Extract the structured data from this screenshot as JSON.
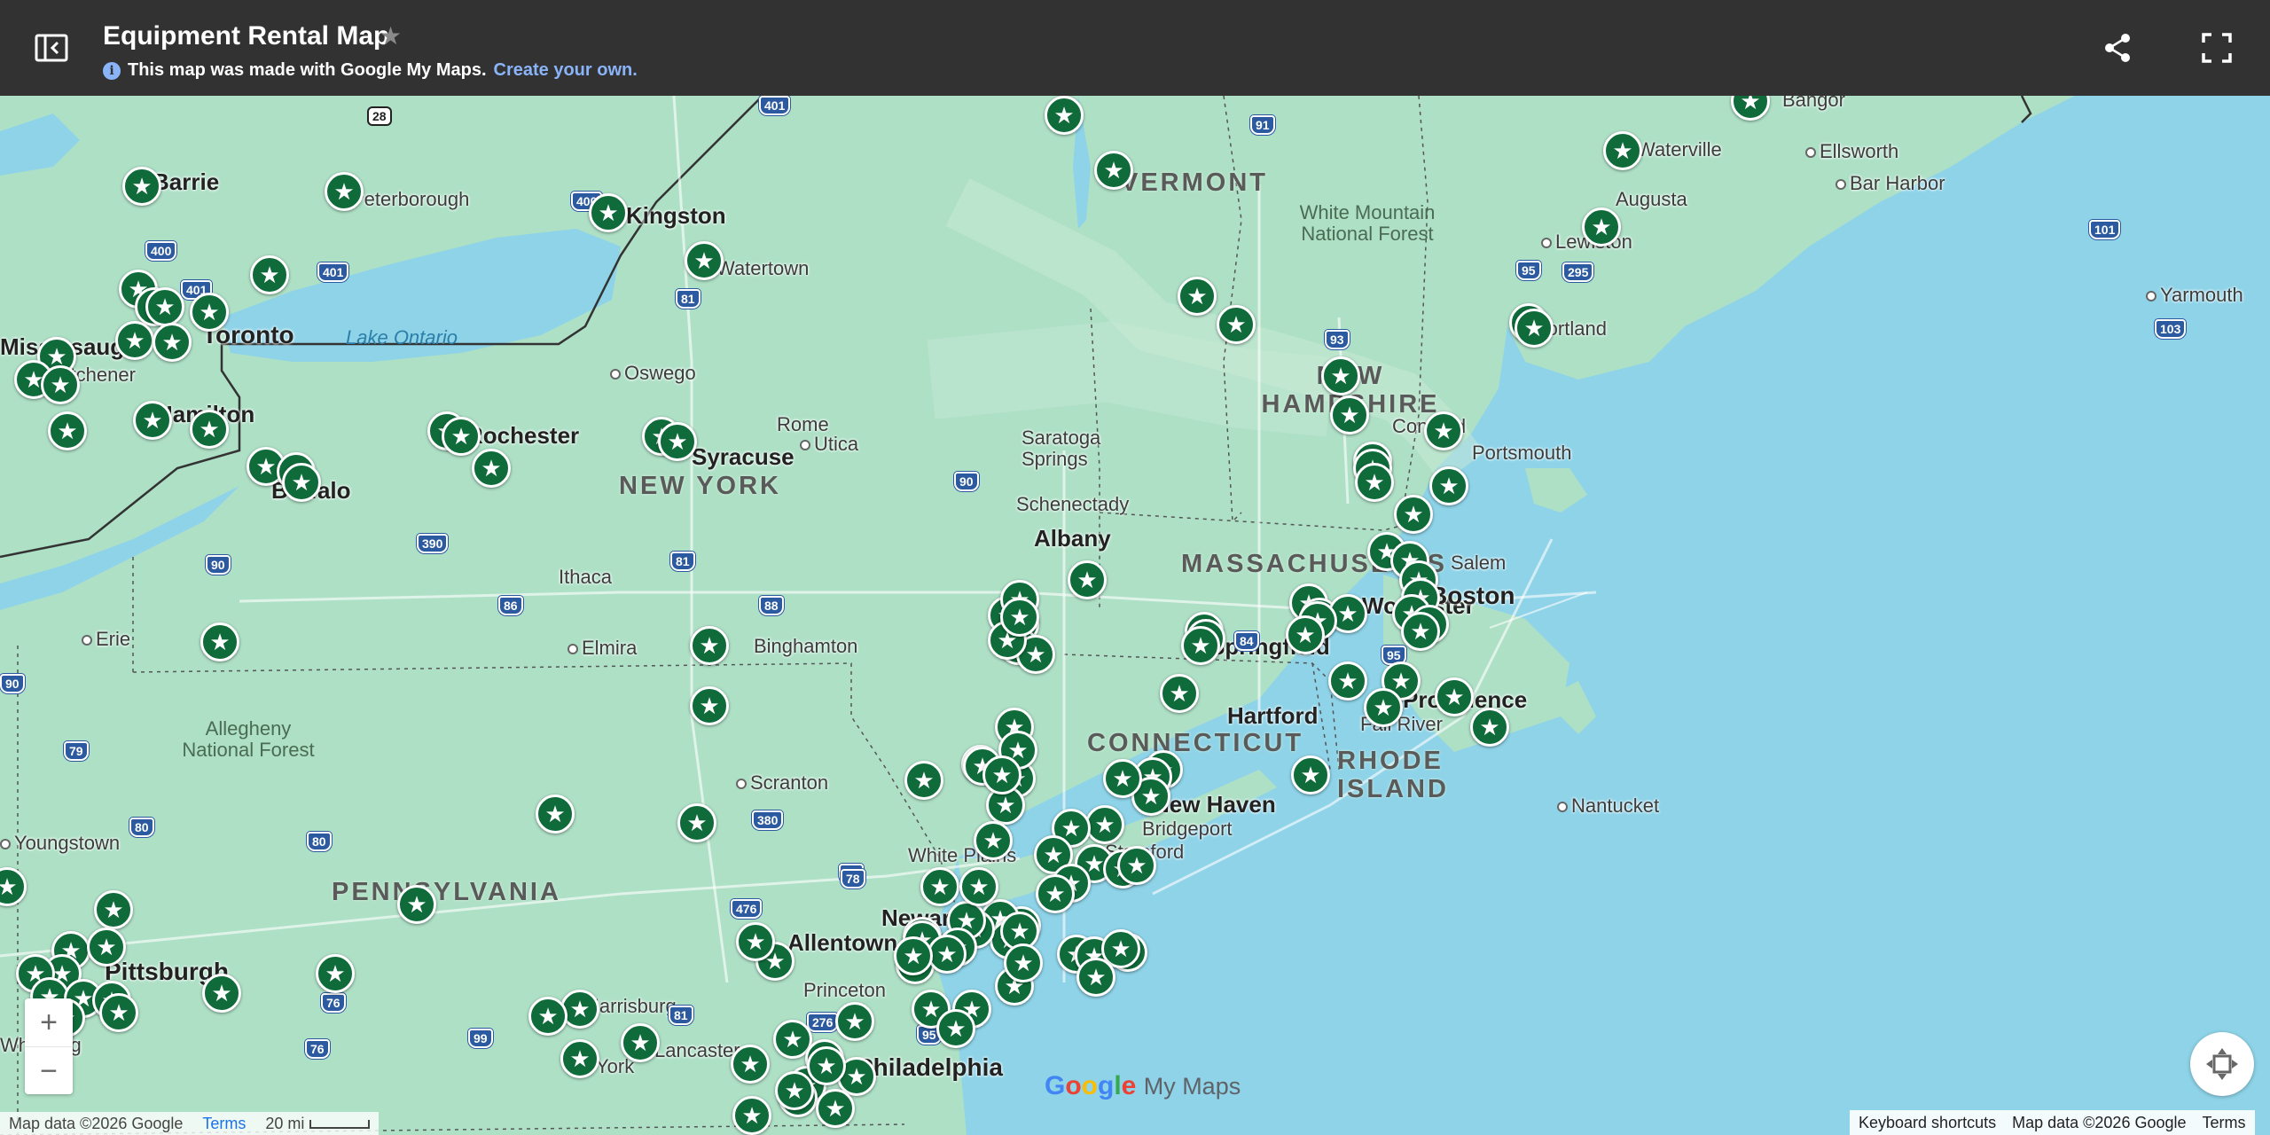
{
  "header": {
    "title": "Equipment Rental Map",
    "subtitle_text": "This map was made with Google My Maps.",
    "create_link": "Create your own.",
    "info_glyph": "i"
  },
  "map": {
    "cities": [
      "Barrie",
      "Peterborough",
      "Kingston",
      "Watertown",
      "Toronto",
      "Mississauga",
      "Kitchener",
      "Hamilton",
      "Oswego",
      "Rochester",
      "Syracuse",
      "Rome",
      "Utica",
      "Buffalo",
      "Ithaca",
      "Elmira",
      "Binghamton",
      "Erie",
      "Scranton",
      "Allentown",
      "Youngstown",
      "Pittsburgh",
      "Harrisburg",
      "Lancaster",
      "York",
      "Wheeling",
      "Princeton",
      "Philadelphia",
      "Newark",
      "White Plains",
      "Stamford",
      "Bridgeport",
      "New Haven",
      "Hartford",
      "Springfield",
      "Worcester",
      "Boston",
      "Salem",
      "Providence",
      "Fall River",
      "Nantucket",
      "Schenectady",
      "Albany",
      "Saratoga Springs",
      "Concord",
      "Portsmouth",
      "Portland",
      "Lewiston",
      "Augusta",
      "Waterville",
      "Ellsworth",
      "Bar Harbor",
      "Bangor",
      "Yarmouth"
    ],
    "states": [
      "NEW YORK",
      "PENNSYLVANIA",
      "MASSACHUSETTS",
      "CONNECTICUT",
      "RHODE ISLAND",
      "NEW HAMPSHIRE",
      "VERMONT"
    ],
    "forests": [
      "White Mountain National Forest",
      "Allegheny National Forest"
    ],
    "water": [
      "Lake Ontario"
    ],
    "highways": [
      "28",
      "401",
      "400",
      "401",
      "401",
      "400",
      "81",
      "90",
      "390",
      "86",
      "81",
      "88",
      "90",
      "91",
      "93",
      "95",
      "84",
      "95",
      "90",
      "79",
      "80",
      "80",
      "380",
      "80",
      "476",
      "78",
      "76",
      "99",
      "81",
      "76",
      "276",
      "95",
      "295",
      "101",
      "103"
    ],
    "marker_count": 150,
    "marker_icon": "star-icon",
    "marker_color": "#0f6b3a"
  },
  "controls": {
    "zoom_in": "+",
    "zoom_out": "−"
  },
  "branding": {
    "google": "Google",
    "mymaps": "My Maps"
  },
  "footer": {
    "map_data_left": "Map data ©2026 Google",
    "terms_left": "Terms",
    "scale": "20 mi",
    "keyboard": "Keyboard shortcuts",
    "map_data_right": "Map data ©2026 Google",
    "terms_right": "Terms"
  }
}
